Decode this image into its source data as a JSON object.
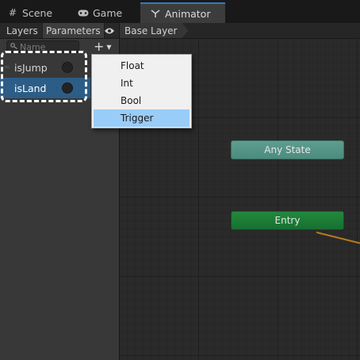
{
  "tabs": [
    {
      "label": "Scene",
      "icon": "grid-icon"
    },
    {
      "label": "Game",
      "icon": "gamepad-icon"
    },
    {
      "label": "Animator",
      "icon": "animator-icon",
      "active": true
    }
  ],
  "subtabs": {
    "layers": "Layers",
    "parameters": "Parameters",
    "eye_icon": "eye-icon"
  },
  "breadcrumb": {
    "layer": "Base Layer"
  },
  "search": {
    "placeholder": "Name",
    "value": ""
  },
  "add_button": {
    "icon": "plus-icon",
    "dropdown_icon": "chevron-down-icon"
  },
  "parameters": [
    {
      "name": "isJump",
      "selected": false
    },
    {
      "name": "isLand",
      "selected": true
    }
  ],
  "menu": {
    "items": [
      {
        "label": "Float"
      },
      {
        "label": "Int"
      },
      {
        "label": "Bool"
      },
      {
        "label": "Trigger",
        "hovered": true
      }
    ]
  },
  "graph": {
    "nodes": {
      "any_state": "Any State",
      "entry": "Entry"
    }
  },
  "colors": {
    "accent": "#3a79bb",
    "selected_row": "#2c5d87",
    "any_state_node": "#5e9e90",
    "entry_node": "#22893d",
    "menu_hover": "#99ccf7",
    "transition": "#b47a1c"
  }
}
